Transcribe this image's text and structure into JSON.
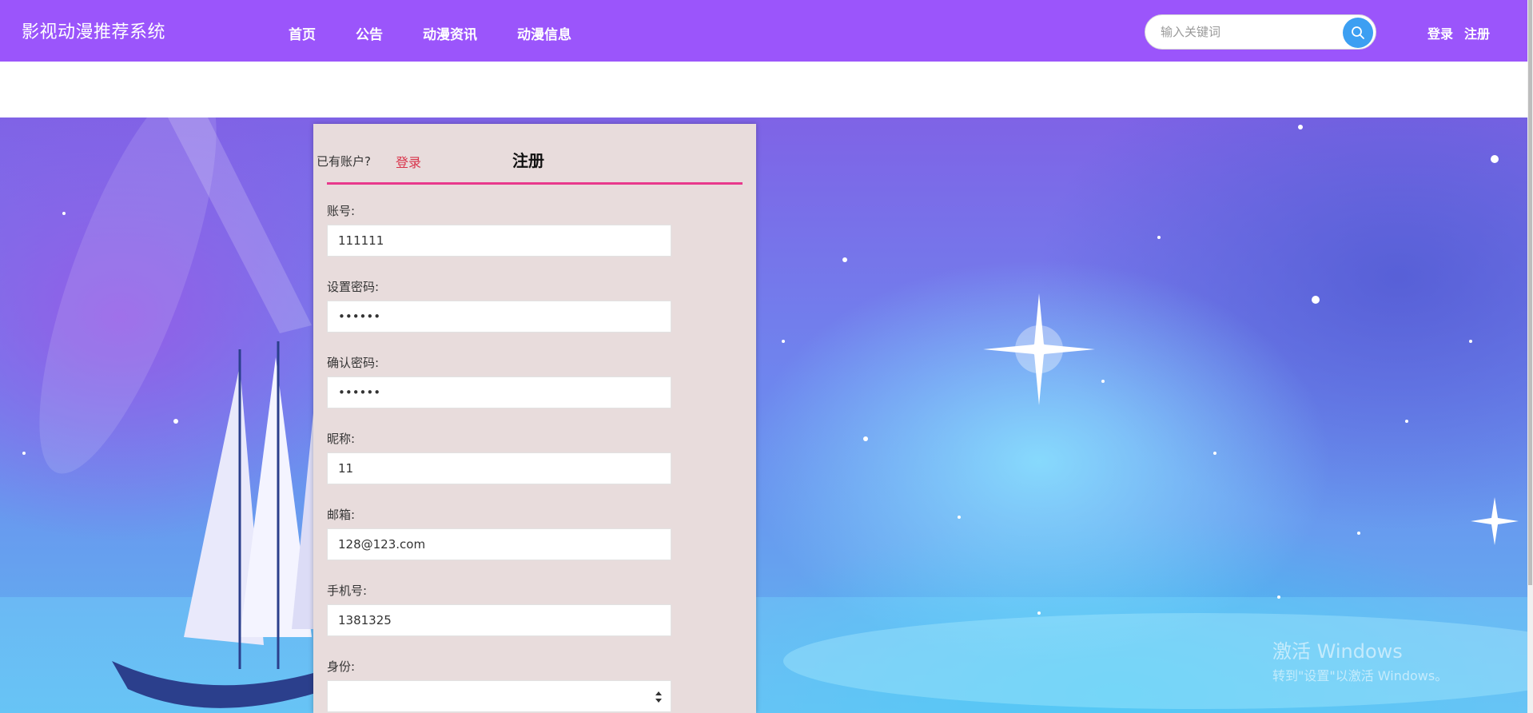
{
  "header": {
    "brand": "影视动漫推荐系统",
    "nav": [
      "首页",
      "公告",
      "动漫资讯",
      "动漫信息"
    ],
    "search_placeholder": "输入关键词",
    "search_icon": "search-icon",
    "login": "登录",
    "register": "注册"
  },
  "panel": {
    "has_account": "已有账户?",
    "login_link": "登录",
    "title": "注册",
    "fields": {
      "account": {
        "label": "账号:",
        "value": "111111"
      },
      "password": {
        "label": "设置密码:",
        "value": "••••••"
      },
      "confirm": {
        "label": "确认密码:",
        "value": "••••••"
      },
      "nickname": {
        "label": "昵称:",
        "value": "11"
      },
      "email": {
        "label": "邮箱:",
        "value": "128@123.com"
      },
      "phone": {
        "label": "手机号:",
        "value": "1381325"
      },
      "identity": {
        "label": "身份:",
        "value": ""
      }
    }
  },
  "watermark": {
    "line1": "激活 Windows",
    "line2": "转到\"设置\"以激活 Windows。"
  },
  "colors": {
    "header_bg": "#9b55fb",
    "panel_bg": "#e8dcdc",
    "accent_underline": "#e8398c",
    "login_link": "#d9334a",
    "search_button": "#3c9ff2"
  }
}
